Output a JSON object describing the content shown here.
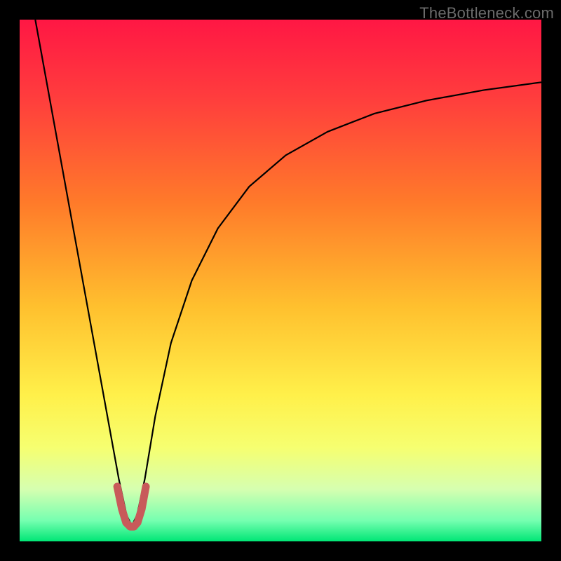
{
  "watermark": {
    "text": "TheBottleneck.com"
  },
  "chart_data": {
    "type": "line",
    "title": "",
    "xlabel": "",
    "ylabel": "",
    "xlim": [
      0,
      100
    ],
    "ylim": [
      0,
      100
    ],
    "grid": false,
    "background_gradient": {
      "stops": [
        {
          "offset": 0.0,
          "color": "#ff1744"
        },
        {
          "offset": 0.15,
          "color": "#ff3d3d"
        },
        {
          "offset": 0.35,
          "color": "#ff7a2a"
        },
        {
          "offset": 0.55,
          "color": "#ffc02e"
        },
        {
          "offset": 0.72,
          "color": "#fff04a"
        },
        {
          "offset": 0.82,
          "color": "#f6ff70"
        },
        {
          "offset": 0.9,
          "color": "#d6ffb0"
        },
        {
          "offset": 0.96,
          "color": "#76ffb0"
        },
        {
          "offset": 1.0,
          "color": "#00e676"
        }
      ]
    },
    "series": [
      {
        "name": "bottleneck-curve",
        "color": "#000000",
        "width": 2.2,
        "x": [
          3,
          5,
          7,
          9,
          11,
          13,
          15,
          17,
          19,
          20.5,
          21.5,
          22.5,
          24,
          26,
          29,
          33,
          38,
          44,
          51,
          59,
          68,
          78,
          89,
          100
        ],
        "y": [
          100,
          89,
          78,
          67,
          56,
          45,
          34,
          23,
          12,
          5,
          3,
          5,
          12,
          24,
          38,
          50,
          60,
          68,
          74,
          78.5,
          82,
          84.5,
          86.5,
          88
        ]
      },
      {
        "name": "highlight-u",
        "color": "#c85a5a",
        "width": 11,
        "linecap": "round",
        "x": [
          18.7,
          19.6,
          20.4,
          21.2,
          21.9,
          22.6,
          23.4,
          24.2
        ],
        "y": [
          10.5,
          6.2,
          3.6,
          2.8,
          2.8,
          3.6,
          6.2,
          10.5
        ]
      }
    ]
  }
}
